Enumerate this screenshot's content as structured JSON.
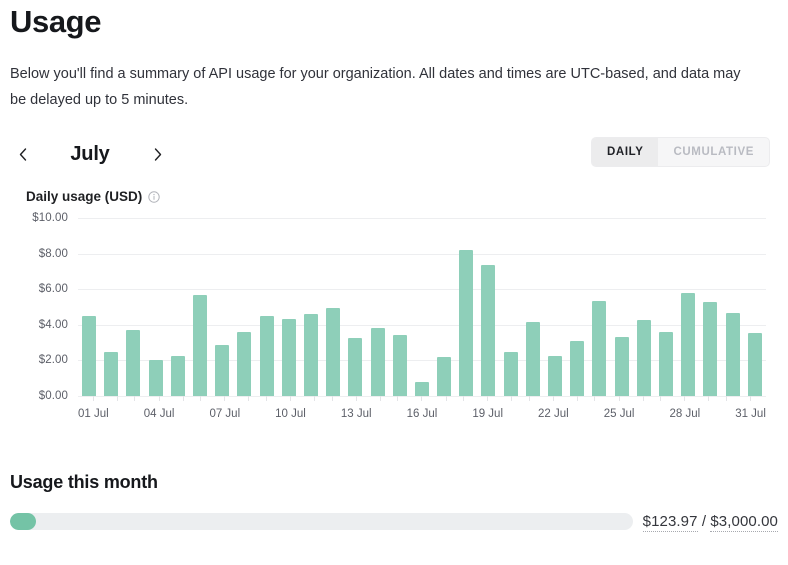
{
  "header": {
    "title": "Usage",
    "description": "Below you'll find a summary of API usage for your organization. All dates and times are UTC-based, and data may be delayed up to 5 minutes."
  },
  "controls": {
    "prev_icon": "chevron-left-icon",
    "next_icon": "chevron-right-icon",
    "month": "July",
    "view_toggle": {
      "options": [
        "DAILY",
        "CUMULATIVE"
      ],
      "selected": "DAILY"
    }
  },
  "chart_section": {
    "title": "Daily usage (USD)",
    "info_icon": "info-circle-icon"
  },
  "usage_summary": {
    "title": "Usage this month",
    "current": "$123.97",
    "separator": "/",
    "limit": "$3,000.00",
    "combined": "$123.97 / $3,000.00",
    "percent": 4.1
  },
  "colors": {
    "bar": "#8ecfb9",
    "progress_fill": "#74c3a6",
    "progress_track": "#eceef0",
    "gridline": "#edeef0",
    "toggle_active_bg": "#ececed"
  },
  "chart_data": {
    "type": "bar",
    "title": "Daily usage (USD)",
    "xlabel": "",
    "ylabel": "",
    "ylim": [
      0,
      10
    ],
    "ytick_labels": [
      "$10.00",
      "$8.00",
      "$6.00",
      "$4.00",
      "$2.00",
      "$0.00"
    ],
    "ytick_values": [
      10,
      8,
      6,
      4,
      2,
      0
    ],
    "grid": true,
    "legend": "none",
    "categories": [
      "01 Jul",
      "02 Jul",
      "03 Jul",
      "04 Jul",
      "05 Jul",
      "06 Jul",
      "07 Jul",
      "08 Jul",
      "09 Jul",
      "10 Jul",
      "11 Jul",
      "12 Jul",
      "13 Jul",
      "14 Jul",
      "15 Jul",
      "16 Jul",
      "17 Jul",
      "18 Jul",
      "19 Jul",
      "20 Jul",
      "21 Jul",
      "22 Jul",
      "23 Jul",
      "24 Jul",
      "25 Jul",
      "26 Jul",
      "27 Jul",
      "28 Jul",
      "29 Jul",
      "30 Jul",
      "31 Jul"
    ],
    "xtick_labels": [
      "01 Jul",
      "04 Jul",
      "07 Jul",
      "10 Jul",
      "13 Jul",
      "16 Jul",
      "19 Jul",
      "22 Jul",
      "25 Jul",
      "28 Jul",
      "31 Jul"
    ],
    "xtick_interval": 3,
    "values": [
      4.5,
      2.45,
      3.7,
      2.0,
      2.25,
      5.65,
      2.85,
      3.6,
      4.5,
      4.3,
      4.6,
      4.95,
      3.25,
      3.8,
      3.45,
      0.8,
      2.2,
      8.2,
      7.35,
      2.45,
      4.15,
      2.25,
      3.1,
      5.35,
      3.3,
      4.25,
      3.6,
      5.8,
      5.3,
      4.65,
      3.55
    ]
  }
}
